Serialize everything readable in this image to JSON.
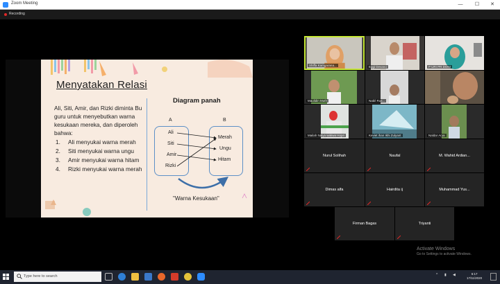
{
  "window": {
    "title": "Zoom Meeting",
    "min": "—",
    "max": "☐",
    "close": "✕"
  },
  "recording": {
    "label": "Recording"
  },
  "slide": {
    "title": "Menyatakan Relasi",
    "intro": "Ali, Siti, Amir, dan Rizki diminta Bu guru untuk menyebutkan warna kesukaan mereka, dan diperoleh bahwa:",
    "items": [
      {
        "num": "1.",
        "text": "Ali menyukai warna merah"
      },
      {
        "num": "2.",
        "text": "Siti menyukai warna ungu"
      },
      {
        "num": "3.",
        "text": "Amir menyukai warna hitam"
      },
      {
        "num": "4.",
        "text": "Rizki menyukai warna merah"
      }
    ],
    "diagram": {
      "title": "Diagram panah",
      "set_a_label": "A",
      "set_b_label": "B",
      "set_a": [
        "Ali",
        "Siti",
        "Amir",
        "Rizki"
      ],
      "set_b": [
        "Merah",
        "Ungu",
        "Hitam"
      ],
      "caption": "\"Warna Kesukaan\"",
      "arrow_color": "#1d1d1d",
      "box_color": "#5b8fc7",
      "curve_color": "#3d6fa8"
    }
  },
  "participants": {
    "video": [
      {
        "name": "Shiffa Kamgarana...",
        "active": true
      },
      {
        "name": "Eggi Devano",
        "active": false
      },
      {
        "name": "P URI PR DONI",
        "active": false
      },
      {
        "name": "Maulidin Muth",
        "active": false
      },
      {
        "name": "Nabil Rus...",
        "active": false
      },
      {
        "name": "",
        "active": false
      },
      {
        "name": "Mailah Nalya wakwa Hopri",
        "active": false
      },
      {
        "name": "Keviet ihan Ikhi Zulyant",
        "active": false
      },
      {
        "name": "Naldar Arya",
        "active": false
      }
    ],
    "audio_only": [
      {
        "name": "Nurul Solihah"
      },
      {
        "name": "Naufal"
      },
      {
        "name": "M. Wahid Ardian..."
      },
      {
        "name": "Dimas alfa"
      },
      {
        "name": "Hairdita ij"
      },
      {
        "name": "Muhammad Yus..."
      },
      {
        "name": "Firman Bagas"
      },
      {
        "name": "Triyanti"
      }
    ]
  },
  "watermark": {
    "heading": "Activate Windows",
    "sub": "Go to Settings to activate Windows."
  },
  "taskbar": {
    "search_placeholder": "Type here to search",
    "clock_time": "6:17",
    "clock_date": "17/11/2020"
  },
  "colors": {
    "active_speaker_border": "#c6e836",
    "mic_muted": "#e02828",
    "zoom_blue": "#2d8cff"
  }
}
